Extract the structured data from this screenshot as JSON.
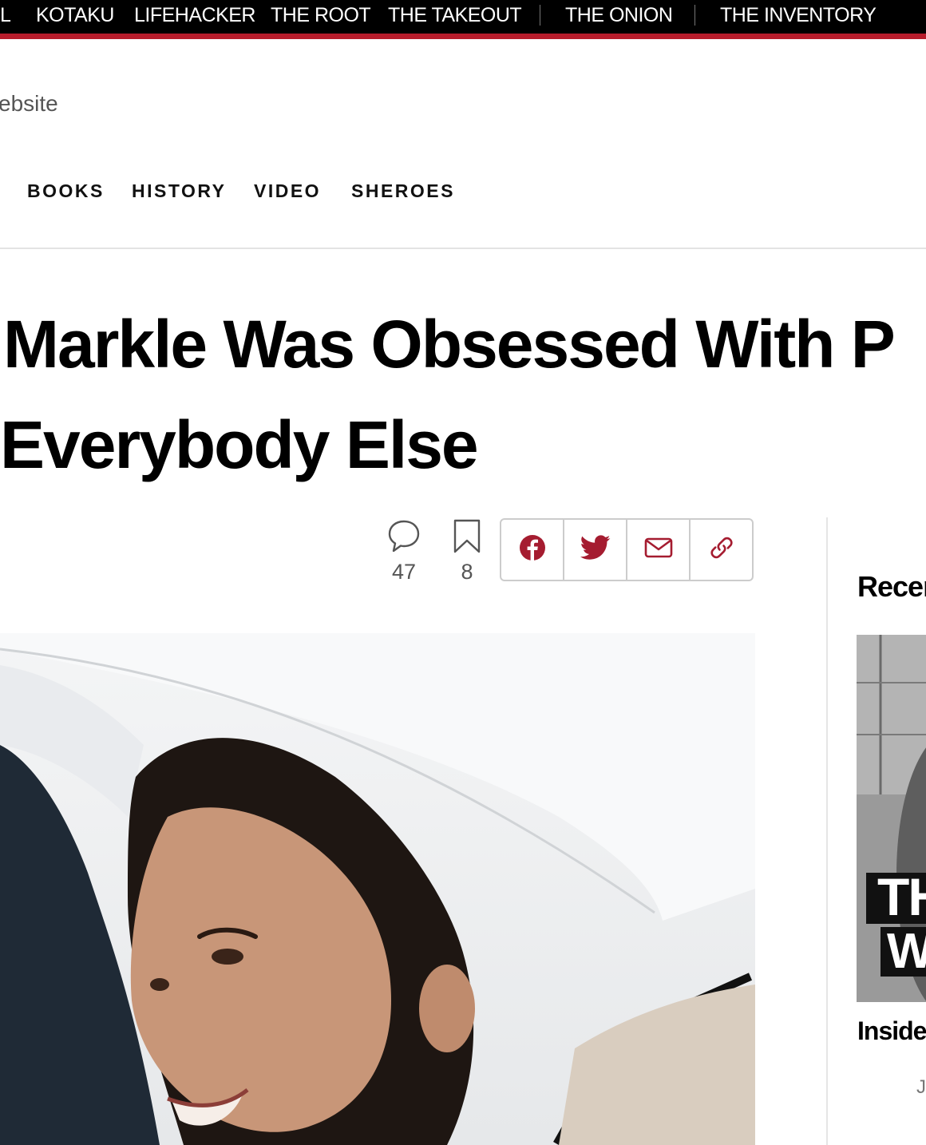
{
  "network_nav": {
    "items": [
      "L",
      "KOTAKU",
      "LIFEHACKER",
      "THE ROOT",
      "THE TAKEOUT",
      "THE ONION",
      "THE INVENTORY"
    ],
    "bar_color": "#000000",
    "accent_color": "#b71c2b"
  },
  "site": {
    "partial_text": "ebsite"
  },
  "section_nav": {
    "items": [
      "BOOKS",
      "HISTORY",
      "VIDEO",
      "SHEROES"
    ]
  },
  "article": {
    "headline_line1": "Markle Was Obsessed With P",
    "headline_line2": "Everybody Else",
    "comments_count": "47",
    "bookmarks_count": "8",
    "share_icons": [
      "facebook-icon",
      "twitter-icon",
      "email-icon",
      "link-icon"
    ],
    "share_color": "#a51c30"
  },
  "sidebar": {
    "recent_title": "Recer",
    "recent_item_image_text": [
      "TH",
      "W"
    ],
    "recent_item_title": "Inside",
    "recent_item_meta": "J"
  }
}
